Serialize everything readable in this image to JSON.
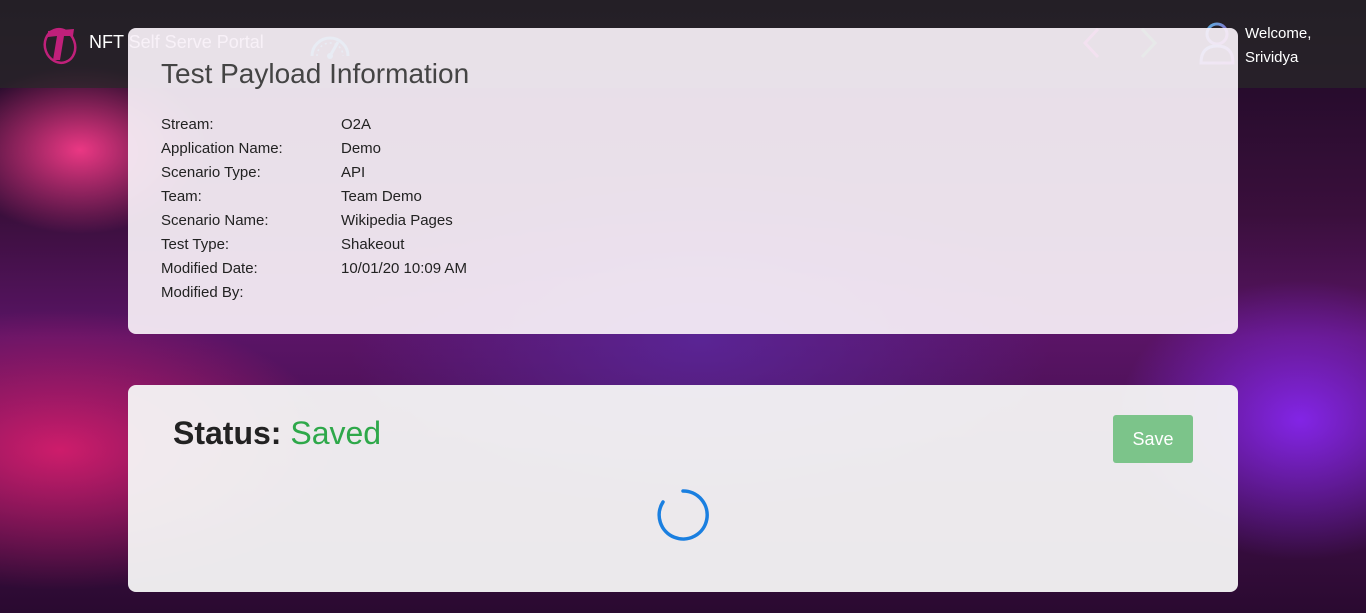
{
  "header": {
    "app_title": "NFT Self Serve Portal",
    "welcome_line1": "Welcome,",
    "welcome_line2": "Srividya",
    "icons": {
      "logo": "telstra-logo",
      "dashboard": "speedometer-icon",
      "back": "chevron-left-icon",
      "forward": "chevron-right-icon",
      "user": "user-avatar-icon"
    },
    "colors": {
      "back": "#b0208c",
      "forward": "#1a8a2e",
      "gauge": "#1fb0c0"
    }
  },
  "payload_info": {
    "title": "Test Payload Information",
    "fields": [
      {
        "label": "Stream:",
        "value": "O2A"
      },
      {
        "label": "Application Name:",
        "value": "Demo"
      },
      {
        "label": "Scenario Type:",
        "value": "API"
      },
      {
        "label": "Team:",
        "value": "Team Demo"
      },
      {
        "label": "Scenario Name:",
        "value": "Wikipedia Pages"
      },
      {
        "label": "Test Type:",
        "value": "Shakeout"
      },
      {
        "label": "Modified Date:",
        "value": "10/01/20 10:09 AM"
      },
      {
        "label": "Modified By:",
        "value": ""
      }
    ]
  },
  "status_panel": {
    "status_label": "Status:",
    "status_value": "Saved",
    "status_color": "#2ea84a",
    "save_label": "Save",
    "save_color": "#7cc48a",
    "loading_icon": "spinner-icon"
  }
}
